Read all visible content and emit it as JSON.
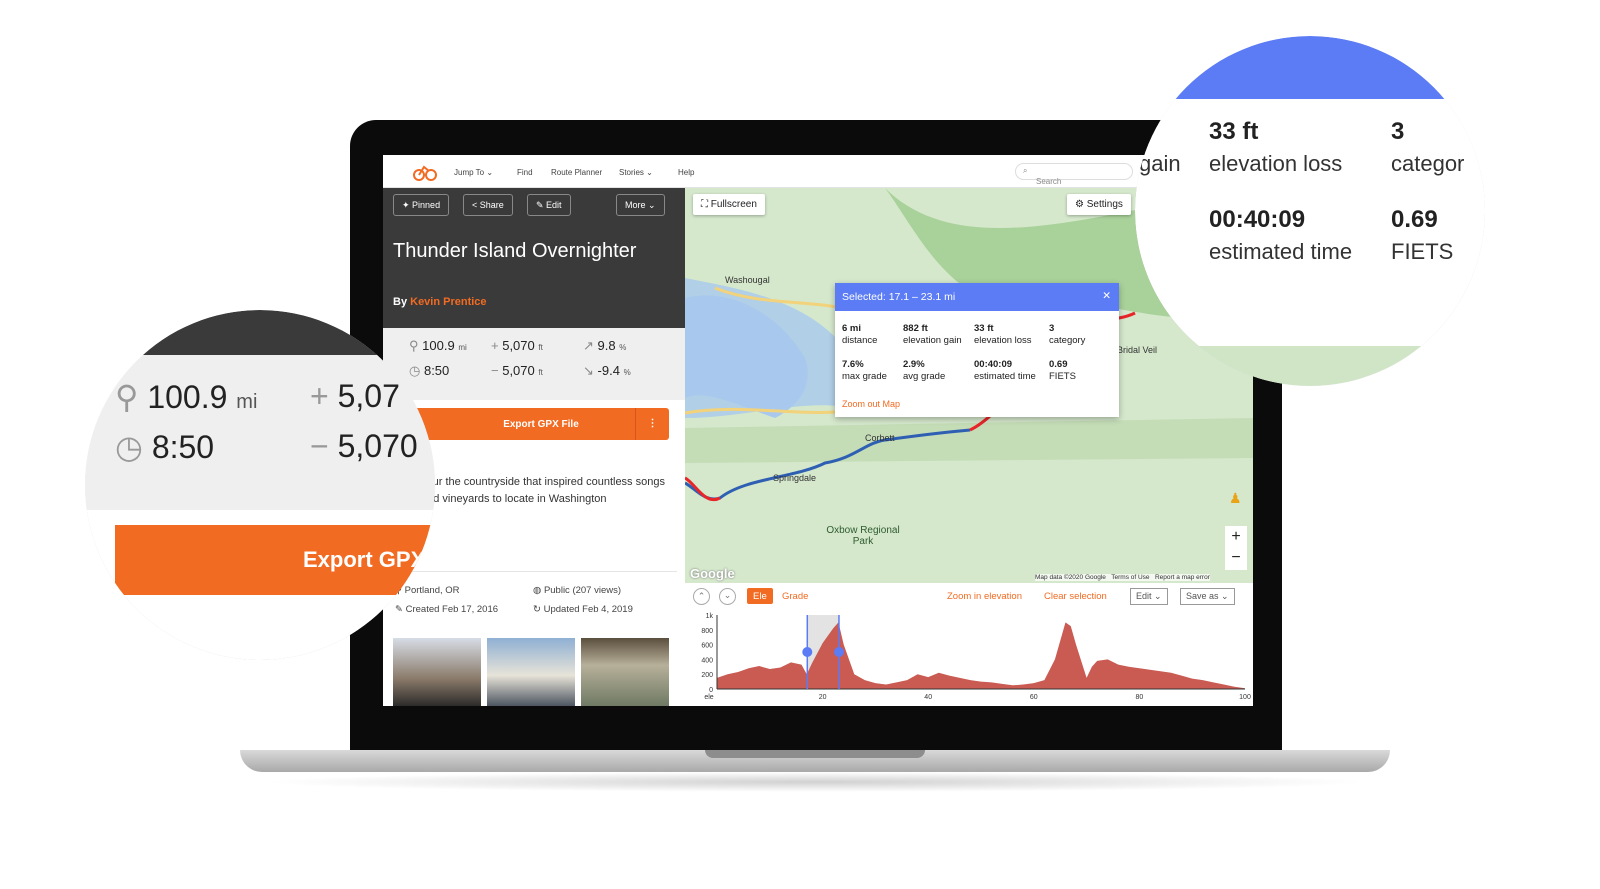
{
  "nav": {
    "items": [
      "Jump To",
      "Find",
      "Route Planner",
      "Stories",
      "Help"
    ],
    "search_placeholder": "Search"
  },
  "toolbar": {
    "pinned": "Pinned",
    "share": "Share",
    "edit": "Edit",
    "more": "More"
  },
  "route": {
    "title": "Thunder Island Overnighter",
    "by_label": "By",
    "author": "Kevin Prentice",
    "distance": "100.9",
    "distance_unit": "mi",
    "gain": "5,070",
    "gain_unit": "ft",
    "max_grade": "9.8",
    "grade_unit": "%",
    "time": "8:50",
    "loss": "5,070",
    "loss_unit": "ft",
    "min_grade": "-9.4",
    "export": "Export GPX File",
    "description": "Tour the countryside that inspired countless songs and vineyards to locate in Washington",
    "location": "Portland, OR",
    "visibility": "Public (207 views)",
    "created": "Created Feb 17, 2016",
    "updated": "Updated Feb 4, 2019"
  },
  "map": {
    "fullscreen": "Fullscreen",
    "settings": "Settings",
    "labels": [
      "Washougal",
      "Corbett",
      "Springdale",
      "Oxbow Regional Park",
      "Bridal Veil"
    ],
    "attribution": [
      "Map data ©2020 Google",
      "Terms of Use",
      "Report a map error"
    ],
    "google": "Google",
    "popup": {
      "title": "Selected: 17.1 – 23.1 mi",
      "zoom_out": "Zoom out Map",
      "stats": [
        {
          "v": "6 mi",
          "l": "distance"
        },
        {
          "v": "882 ft",
          "l": "elevation gain"
        },
        {
          "v": "33 ft",
          "l": "elevation loss"
        },
        {
          "v": "3",
          "l": "category"
        },
        {
          "v": "7.6%",
          "l": "max grade"
        },
        {
          "v": "2.9%",
          "l": "avg grade"
        },
        {
          "v": "00:40:09",
          "l": "estimated time"
        },
        {
          "v": "0.69",
          "l": "FIETS"
        }
      ]
    }
  },
  "elevation": {
    "ele": "Ele",
    "grade": "Grade",
    "zoom_in": "Zoom in elevation",
    "clear": "Clear selection",
    "edit": "Edit",
    "save_as": "Save as",
    "y_ticks": [
      "1k",
      "800",
      "600",
      "400",
      "200",
      "0"
    ],
    "x_ticks": [
      "ele",
      "20",
      "40",
      "60",
      "80",
      "100"
    ]
  },
  "chart_data": {
    "type": "area",
    "xlabel": "",
    "ylabel": "",
    "xlim": [
      0,
      100
    ],
    "ylim": [
      0,
      1000
    ],
    "selection": [
      17.1,
      23.1
    ],
    "x": [
      0,
      2,
      4,
      6,
      8,
      10,
      12,
      14,
      16,
      17,
      18,
      20,
      22,
      23,
      24,
      26,
      28,
      30,
      32,
      34,
      36,
      38,
      40,
      42,
      44,
      46,
      48,
      50,
      52,
      54,
      56,
      58,
      60,
      62,
      64,
      66,
      67,
      68,
      70,
      71,
      72,
      74,
      76,
      78,
      80,
      82,
      84,
      86,
      88,
      90,
      92,
      94,
      96,
      98,
      100
    ],
    "values": [
      150,
      200,
      230,
      280,
      310,
      270,
      290,
      360,
      330,
      200,
      350,
      620,
      820,
      900,
      600,
      200,
      120,
      80,
      60,
      90,
      120,
      200,
      160,
      220,
      180,
      150,
      120,
      100,
      90,
      70,
      50,
      60,
      80,
      120,
      400,
      900,
      850,
      600,
      150,
      300,
      380,
      400,
      330,
      300,
      280,
      260,
      240,
      220,
      180,
      140,
      120,
      90,
      60,
      30,
      10
    ]
  },
  "zoom_left": {
    "distance": "100.9",
    "unit": "mi",
    "gain": "5,07",
    "time": "8:50",
    "loss": "5,070",
    "export": "Export GPX"
  },
  "zoom_right": {
    "gain_label": "gain",
    "loss_v": "33 ft",
    "loss_l": "elevation loss",
    "cat_v": "3",
    "cat_l": "categor",
    "time_v": "00:40:09",
    "time_l": "estimated time",
    "fiets_v": "0.69",
    "fiets_l": "FIETS"
  },
  "colors": {
    "accent": "#f26b22",
    "selection": "#5b7cf5",
    "elevation_fill": "#c95b53",
    "route": "#2f5fb3",
    "route_alt": "#e8262a"
  }
}
